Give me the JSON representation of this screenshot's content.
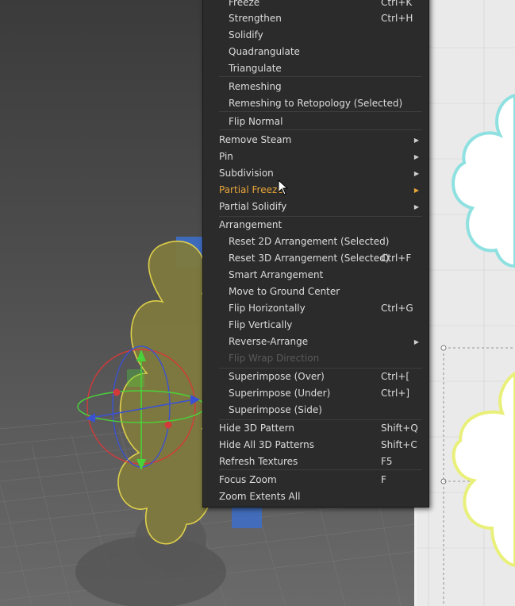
{
  "menu": {
    "items": [
      {
        "label": "Freeze",
        "shortcut": "Ctrl+K",
        "sub": true,
        "arrow": false,
        "disabled": false,
        "highlight": false
      },
      {
        "label": "Strengthen",
        "shortcut": "Ctrl+H",
        "sub": true,
        "arrow": false,
        "disabled": false,
        "highlight": false
      },
      {
        "label": "Solidify",
        "shortcut": "",
        "sub": true,
        "arrow": false,
        "disabled": false,
        "highlight": false
      },
      {
        "label": "Quadrangulate",
        "shortcut": "",
        "sub": true,
        "arrow": false,
        "disabled": false,
        "highlight": false
      },
      {
        "label": "Triangulate",
        "shortcut": "",
        "sub": true,
        "arrow": false,
        "disabled": false,
        "highlight": false
      },
      {
        "label": "Remeshing",
        "shortcut": "",
        "sub": true,
        "arrow": false,
        "disabled": false,
        "highlight": false
      },
      {
        "label": "Remeshing to Retopology (Selected)",
        "shortcut": "",
        "sub": true,
        "arrow": false,
        "disabled": false,
        "highlight": false
      },
      {
        "label": "Flip Normal",
        "shortcut": "",
        "sub": true,
        "arrow": false,
        "disabled": false,
        "highlight": false
      },
      {
        "label": "Remove Steam",
        "shortcut": "",
        "sub": false,
        "arrow": true,
        "disabled": false,
        "highlight": false
      },
      {
        "label": "Pin",
        "shortcut": "",
        "sub": false,
        "arrow": true,
        "disabled": false,
        "highlight": false
      },
      {
        "label": "Subdivision",
        "shortcut": "",
        "sub": false,
        "arrow": true,
        "disabled": false,
        "highlight": false
      },
      {
        "label": "Partial Freeze",
        "shortcut": "",
        "sub": false,
        "arrow": true,
        "disabled": false,
        "highlight": true
      },
      {
        "label": "Partial Solidify",
        "shortcut": "",
        "sub": false,
        "arrow": true,
        "disabled": false,
        "highlight": false
      },
      {
        "label": "Arrangement",
        "shortcut": "",
        "sub": false,
        "arrow": false,
        "disabled": false,
        "highlight": false
      },
      {
        "label": "Reset 2D Arrangement (Selected)",
        "shortcut": "",
        "sub": true,
        "arrow": false,
        "disabled": false,
        "highlight": false
      },
      {
        "label": "Reset 3D Arrangement (Selected)",
        "shortcut": "Ctrl+F",
        "sub": true,
        "arrow": false,
        "disabled": false,
        "highlight": false
      },
      {
        "label": "Smart Arrangement",
        "shortcut": "",
        "sub": true,
        "arrow": false,
        "disabled": false,
        "highlight": false
      },
      {
        "label": "Move to Ground Center",
        "shortcut": "",
        "sub": true,
        "arrow": false,
        "disabled": false,
        "highlight": false
      },
      {
        "label": "Flip Horizontally",
        "shortcut": "Ctrl+G",
        "sub": true,
        "arrow": false,
        "disabled": false,
        "highlight": false
      },
      {
        "label": "Flip Vertically",
        "shortcut": "",
        "sub": true,
        "arrow": false,
        "disabled": false,
        "highlight": false
      },
      {
        "label": "Reverse-Arrange",
        "shortcut": "",
        "sub": true,
        "arrow": true,
        "disabled": false,
        "highlight": false
      },
      {
        "label": "Flip Wrap Direction",
        "shortcut": "",
        "sub": true,
        "arrow": false,
        "disabled": true,
        "highlight": false
      },
      {
        "label": "Superimpose (Over)",
        "shortcut": "Ctrl+[",
        "sub": true,
        "arrow": false,
        "disabled": false,
        "highlight": false
      },
      {
        "label": "Superimpose (Under)",
        "shortcut": "Ctrl+]",
        "sub": true,
        "arrow": false,
        "disabled": false,
        "highlight": false
      },
      {
        "label": "Superimpose (Side)",
        "shortcut": "",
        "sub": true,
        "arrow": false,
        "disabled": false,
        "highlight": false
      },
      {
        "label": "Hide 3D Pattern",
        "shortcut": "Shift+Q",
        "sub": false,
        "arrow": false,
        "disabled": false,
        "highlight": false
      },
      {
        "label": "Hide All 3D Patterns",
        "shortcut": "Shift+C",
        "sub": false,
        "arrow": false,
        "disabled": false,
        "highlight": false
      },
      {
        "label": "Refresh Textures",
        "shortcut": "F5",
        "sub": false,
        "arrow": false,
        "disabled": false,
        "highlight": false
      },
      {
        "label": "Focus Zoom",
        "shortcut": "F",
        "sub": false,
        "arrow": false,
        "disabled": false,
        "highlight": false
      },
      {
        "label": "Zoom Extents All",
        "shortcut": "",
        "sub": false,
        "arrow": false,
        "disabled": false,
        "highlight": false
      }
    ]
  },
  "colors": {
    "menu_bg": "#2b2b2b",
    "highlight_text": "#e8a63b",
    "disabled_text": "#5a5a5a",
    "fabric": "#7f7a3e",
    "selection_outline": "#e6d64a",
    "pattern_cyan_outline": "#8fe0e0",
    "pattern_yellow_outline": "#e9f07a"
  },
  "icons": {
    "cursor": "mouse-pointer-icon",
    "submenu": "chevron-right-icon",
    "gizmo": "transform-gizmo-icon"
  }
}
